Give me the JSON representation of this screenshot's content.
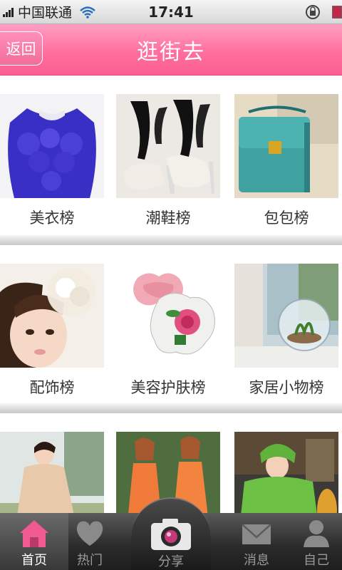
{
  "status_bar": {
    "carrier": "中国联通",
    "time": "17:41"
  },
  "header": {
    "back_label": "返回",
    "title": "逛街去"
  },
  "categories": [
    {
      "label": "美衣榜",
      "photo": "blue-ruffle-top"
    },
    {
      "label": "潮鞋榜",
      "photo": "bow-heels"
    },
    {
      "label": "包包榜",
      "photo": "teal-handbag"
    },
    {
      "label": "配饰榜",
      "photo": "hair-flower-fascinator"
    },
    {
      "label": "美容护肤榜",
      "photo": "flower-tin-balm"
    },
    {
      "label": "家居小物榜",
      "photo": "glass-terrarium"
    },
    {
      "label": "",
      "photo": "beige-cardigan-girl"
    },
    {
      "label": "",
      "photo": "orange-dresses-pair"
    },
    {
      "label": "",
      "photo": "green-hoodie-girl"
    }
  ],
  "tabs": [
    {
      "label": "首页",
      "icon": "home-icon"
    },
    {
      "label": "热门",
      "icon": "heart-icon"
    },
    {
      "label": "分享",
      "icon": "camera-icon"
    },
    {
      "label": "消息",
      "icon": "envelope-icon"
    },
    {
      "label": "自己",
      "icon": "person-icon"
    }
  ],
  "colors": {
    "header_pink": "#ff6f9e",
    "tabbar_dark": "#2a2a2a",
    "active_home_pink": "#f05a8e"
  }
}
